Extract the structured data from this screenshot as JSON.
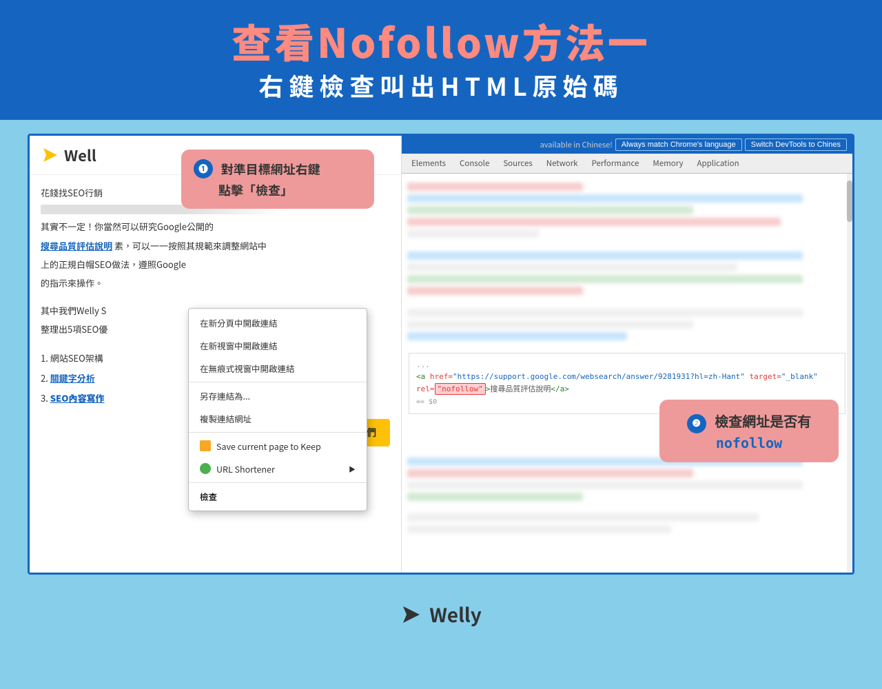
{
  "header": {
    "title": "查看Nofollow方法一",
    "subtitle": "右鍵檢查叫出HTML原始碼"
  },
  "website": {
    "logo_text": "Well",
    "content_line1": "花錢找SEO行銷",
    "article_text1": "其實不一定！你當然可以研究Google公開的",
    "article_link": "搜尋品質評估說明",
    "article_text2": "素，可以一一按照其規範來調整網站中",
    "article_text3": "上的正規白帽SEO做法，遵照Google",
    "article_text4": "的指示來操作。",
    "article_text5": "其中我們Welly S",
    "article_text6": "整理出5項SEO優",
    "list1": "1. 網站SEO架構",
    "list2": "2. 關鍵字分析",
    "list3": "3. SEO內容寫作",
    "cta_button": "聯絡我們"
  },
  "context_menu": {
    "items": [
      "在新分頁中開啟連結",
      "在新視窗中開啟連結",
      "在無痕式視窗中開啟連結",
      "divider",
      "另存連結為...",
      "複製連結網址",
      "divider",
      "Save current page to Keep",
      "URL Shortener",
      "divider",
      "檢查"
    ]
  },
  "tooltip1": {
    "number": "❶",
    "text1": "對準目標網址右鍵",
    "text2": "點擊「檢查」"
  },
  "devtools": {
    "notification": "available in Chinese!",
    "btn1": "Always match Chrome's language",
    "btn2": "Switch DevTools to Chines",
    "tabs": [
      "Elements",
      "Console",
      "Sources",
      "Network",
      "Performance",
      "Memory",
      "Application"
    ],
    "active_tab": "Elements"
  },
  "html_code": {
    "dots": "...",
    "code": "<a href=\"https://support.google.com/websearch/answer/9281931?hl=zh-Hant\" target=\"_blank\" rel=\"nofollow\">搜尋品質評估說明</a>",
    "equals": "== $0"
  },
  "tooltip2": {
    "number": "❷",
    "text1": "檢查網址是否有",
    "text2": "nofollow"
  },
  "footer": {
    "logo_text": "Welly"
  }
}
